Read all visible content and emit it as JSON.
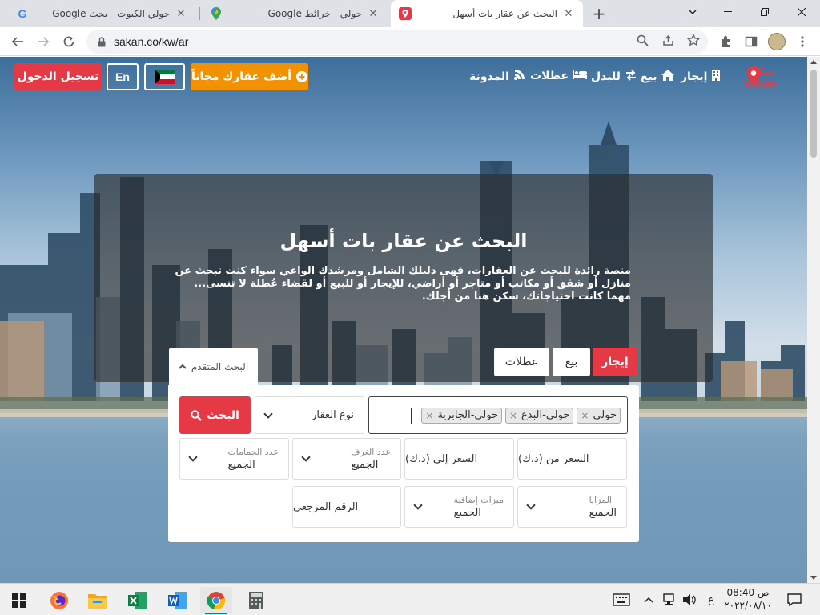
{
  "browser": {
    "tabs": [
      {
        "title": "حولي الكيوت - بحث Google",
        "favicon": "google-g"
      },
      {
        "title": "حولي - خرائط Google",
        "favicon": "google-maps-pin"
      },
      {
        "title": "البحث عن عقار بات أسهل",
        "favicon": "sakan-pin"
      }
    ],
    "url": "sakan.co/kw/ar"
  },
  "site": {
    "logo_ar": "سكن",
    "logo_en": "sakan",
    "nav": [
      {
        "label": "إيجار",
        "icon": "building-icon"
      },
      {
        "label": "بيع",
        "icon": "home-icon"
      },
      {
        "label": "للبدل",
        "icon": "exchange-icon"
      },
      {
        "label": "عطلات",
        "icon": "bed-icon"
      },
      {
        "label": "المدونة",
        "icon": "blog-icon"
      }
    ],
    "add_property": "أضف عقارك مجاناً",
    "lang": "En",
    "login": "تسجيل الدخول"
  },
  "hero": {
    "title": "البحث عن عقار بات أسهل",
    "description": "منصة رائدة للبحث عن العقارات، فهى دليلك الشامل ومرشدك الواعي سواء كنت تبحث عن منازل أو شقق أو مكاتب أو متاجر أو أراضي، للإيجار أو للبيع أو لقضاء عُطلة لا تنسى... مهما كانت احتياجاتك، سكن هنا من أجلك."
  },
  "search": {
    "tabs": [
      "إيجار",
      "بيع",
      "عطلات"
    ],
    "advanced": "البحث المتقدم",
    "locations": [
      "حولي",
      "حولي-البدع",
      "حولي-الجابرية"
    ],
    "property_type": "نوع العقار",
    "button": "البحث",
    "price_from": "السعر من (د.ك)",
    "price_to": "السعر إلى (د.ك)",
    "rooms_label": "عدد الغرف",
    "rooms_value": "الجميع",
    "baths_label": "عدد الحمامات",
    "baths_value": "الجميع",
    "features_label": "المزايا",
    "features_value": "الجميع",
    "extras_label": "ميزات إضافية",
    "extras_value": "الجميع",
    "reference": "الرقم المرجعي"
  },
  "taskbar": {
    "apps": [
      "windows-start",
      "firefox",
      "file-explorer",
      "excel",
      "word",
      "chrome",
      "calculator"
    ],
    "lang_indicator": "ع",
    "time": "08:40",
    "ampm": "ص",
    "date": "٢٠٢٢/٠٨/١٠"
  },
  "colors": {
    "brand": "#e63946",
    "accent": "#f39200"
  }
}
